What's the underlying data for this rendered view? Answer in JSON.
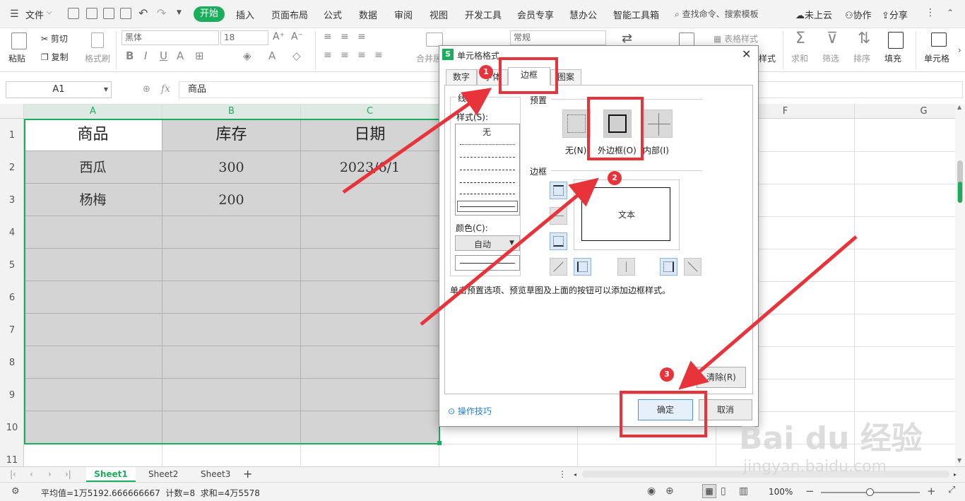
{
  "menu": {
    "file": "文件",
    "tabs": [
      "开始",
      "插入",
      "页面布局",
      "公式",
      "数据",
      "审阅",
      "视图",
      "开发工具",
      "会员专享",
      "慧办公",
      "智能工具箱"
    ],
    "search": "查找命令、搜索模板",
    "cloud": "未上云",
    "collab": "协作",
    "share": "分享"
  },
  "ribbon": {
    "paste": "粘贴",
    "cut": "剪切",
    "copy": "复制",
    "format_painter": "格式刷",
    "font_name": "黑体",
    "font_size": "18",
    "merge": "合并居",
    "number_format": "常规",
    "table_style": "表格样式",
    "cell_style": "样式",
    "sum": "求和",
    "filter": "筛选",
    "sort": "排序",
    "fill": "填充",
    "cell": "单元格"
  },
  "formula": {
    "name_box": "A1",
    "fx": "fx",
    "value": "商品"
  },
  "columns": [
    "A",
    "B",
    "C",
    "D",
    "E",
    "F",
    "G"
  ],
  "rows": [
    "1",
    "2",
    "3",
    "4",
    "5",
    "6",
    "7",
    "8",
    "9",
    "10",
    "11"
  ],
  "table": {
    "header": [
      "商品",
      "库存",
      "日期"
    ],
    "rows": [
      [
        "西瓜",
        "300",
        "2023/6/1"
      ],
      [
        "杨梅",
        "200",
        ""
      ]
    ]
  },
  "sheets": [
    "Sheet1",
    "Sheet2",
    "Sheet3"
  ],
  "status": {
    "summary": "平均值=1万5192.666666667  计数=8  求和=4万5578",
    "zoom": "100%"
  },
  "dialog": {
    "title": "单元格格式",
    "tabs": [
      "数字",
      "字体",
      "边框",
      "图案"
    ],
    "line_group": "线条",
    "style_label": "样式(S):",
    "style_none": "无",
    "color_label": "颜色(C):",
    "color_value": "自动",
    "preset_label": "预置",
    "preset_none": "无(N)",
    "preset_outline": "外边框(O)",
    "preset_inside": "内部(I)",
    "border_label": "边框",
    "preview_text": "文本",
    "hint": "单击预置选项、预览草图及上面的按钮可以添加边框样式。",
    "clear": "清除(R)",
    "tips": "操作技巧",
    "ok": "确定",
    "cancel": "取消"
  },
  "annotations": [
    "1",
    "2",
    "3"
  ],
  "watermark": {
    "brand": "Bai du 经验",
    "url": "jingyan.baidu.com"
  },
  "colors": {
    "accent": "#1aad5c",
    "highlight": "#e8333a"
  }
}
